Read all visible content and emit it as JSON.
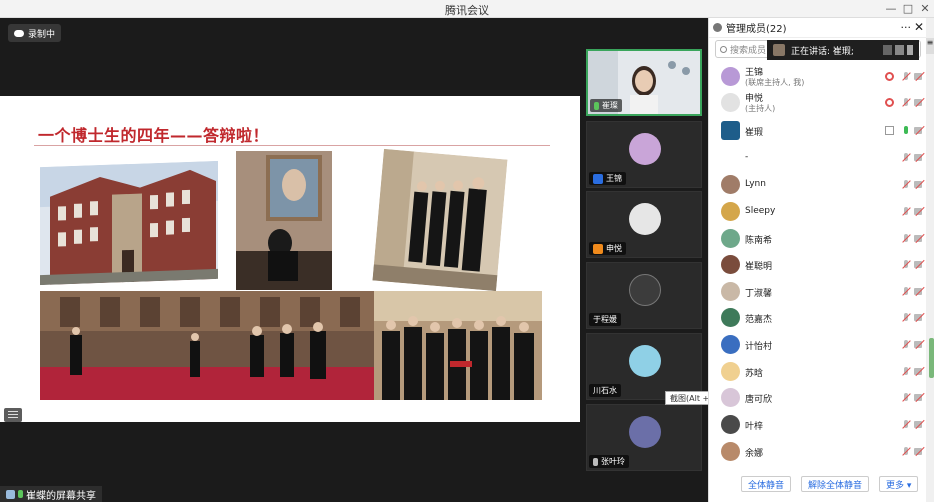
{
  "window": {
    "title": "腾讯会议",
    "controls": [
      "—",
      "□",
      "✕"
    ]
  },
  "recording": {
    "label": "录制中"
  },
  "slide": {
    "title": "一个博士生的四年——答辩啦！"
  },
  "share_bar": {
    "label": "崔蝶的屏幕共享"
  },
  "tooltip": {
    "text": "截图(Alt + A)"
  },
  "video_tiles": [
    {
      "name": "崔璨",
      "active": true
    },
    {
      "name": "王锦"
    },
    {
      "name": "申悦"
    },
    {
      "name": "于程媛"
    },
    {
      "name": "川石水"
    },
    {
      "name": "张叶玲"
    }
  ],
  "panel": {
    "title": "管理成员(22)",
    "more": "···",
    "close": "✕",
    "menu": "≡",
    "search_placeholder": "搜索成员",
    "speaking": "正在讲话: 崔瑕;"
  },
  "members": [
    {
      "name": "王锦",
      "role": "(联席主持人, 我)"
    },
    {
      "name": "申悦",
      "role": "(主持人)"
    },
    {
      "name": "崔瑕"
    },
    {
      "name": "-"
    },
    {
      "name": "Lynn"
    },
    {
      "name": "Sleepy"
    },
    {
      "name": "陈南希"
    },
    {
      "name": "崔聪明"
    },
    {
      "name": "丁淑馨"
    },
    {
      "name": "范嘉杰"
    },
    {
      "name": "计怡村"
    },
    {
      "name": "苏晗"
    },
    {
      "name": "唐可欣"
    },
    {
      "name": "叶梓"
    },
    {
      "name": "余娜"
    }
  ],
  "footer": {
    "mute_all": "全体静音",
    "unmute_all": "解除全体静音",
    "more": "更多 ▾"
  },
  "colors": {
    "accent": "#2a6de0",
    "title_red": "#c0282d",
    "active_green": "#3aa55c"
  }
}
